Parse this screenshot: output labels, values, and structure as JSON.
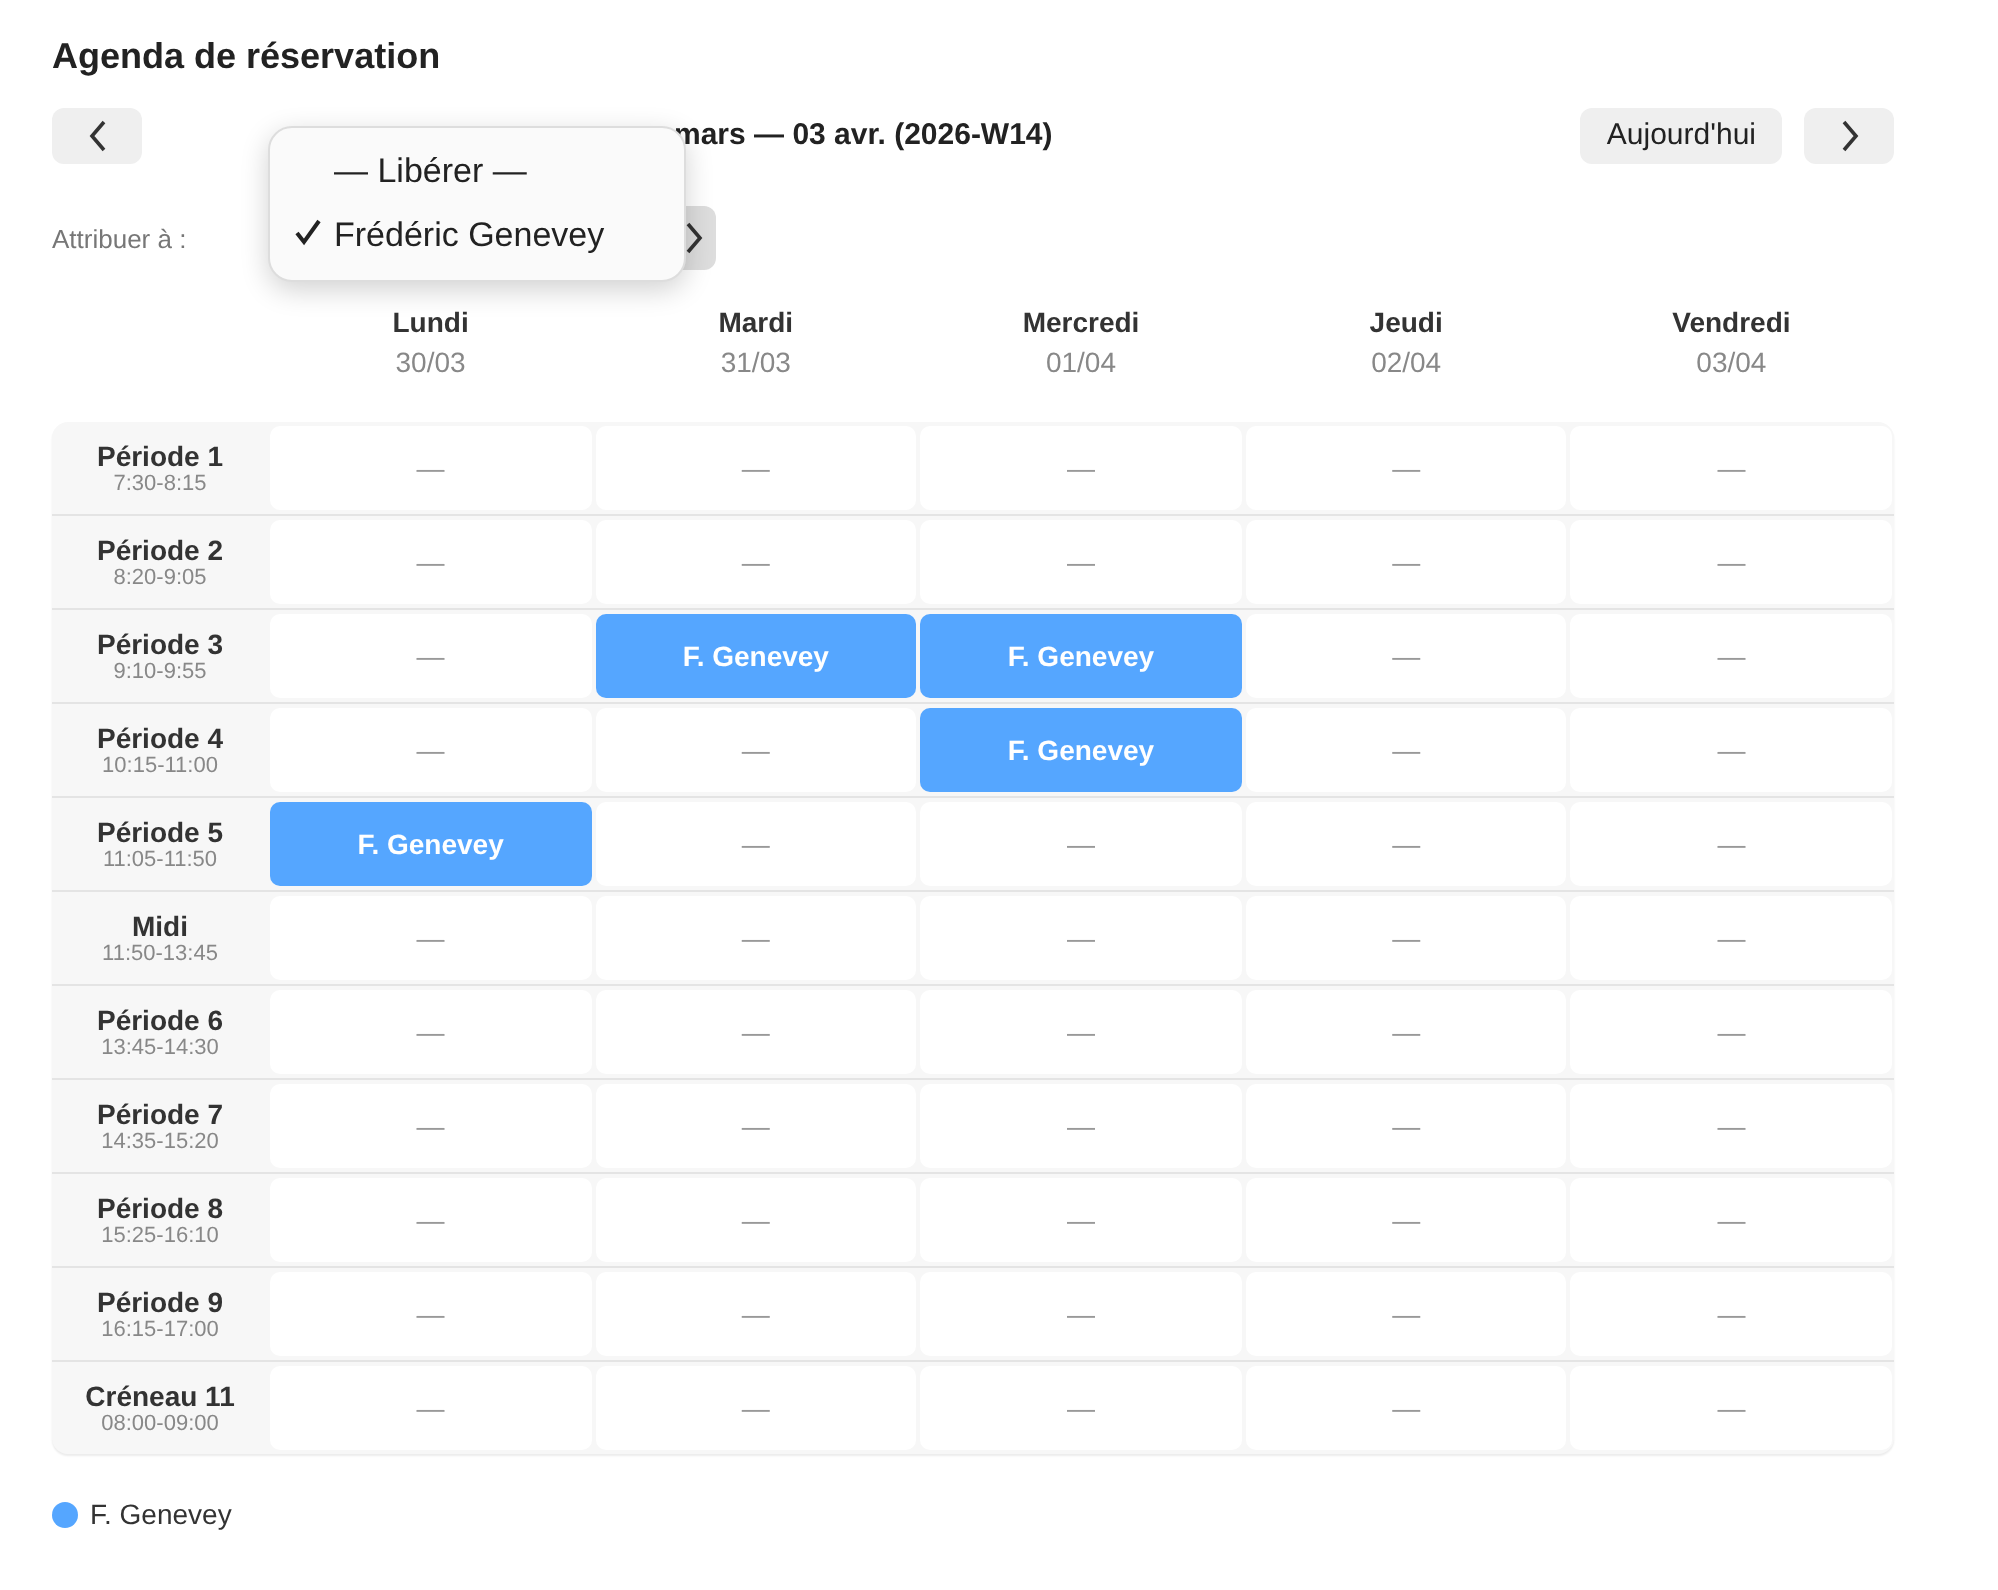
{
  "title": "Agenda de réservation",
  "nav": {
    "today": "Aujourd'hui",
    "week": "mars — 03 avr. (2026-W14)"
  },
  "assign": {
    "label": "Attribuer à :",
    "menu": [
      {
        "label": "— Libérer —",
        "selected": false
      },
      {
        "label": "Frédéric Genevey",
        "selected": true
      }
    ]
  },
  "days": [
    {
      "name": "Lundi",
      "date": "30/03"
    },
    {
      "name": "Mardi",
      "date": "31/03"
    },
    {
      "name": "Mercredi",
      "date": "01/04"
    },
    {
      "name": "Jeudi",
      "date": "02/04"
    },
    {
      "name": "Vendredi",
      "date": "03/04"
    }
  ],
  "rows": [
    {
      "label": "Période 1",
      "time": "7:30-8:15",
      "cells": [
        {
          "kind": "empty",
          "text": "—"
        },
        {
          "kind": "empty",
          "text": "—"
        },
        {
          "kind": "empty",
          "text": "—"
        },
        {
          "kind": "empty",
          "text": "—"
        },
        {
          "kind": "empty",
          "text": "—"
        }
      ]
    },
    {
      "label": "Période 2",
      "time": "8:20-9:05",
      "cells": [
        {
          "kind": "empty",
          "text": "—"
        },
        {
          "kind": "empty",
          "text": "—"
        },
        {
          "kind": "empty",
          "text": "—"
        },
        {
          "kind": "empty",
          "text": "—"
        },
        {
          "kind": "empty",
          "text": "—"
        }
      ]
    },
    {
      "label": "Période 3",
      "time": "9:10-9:55",
      "cells": [
        {
          "kind": "empty",
          "text": "—"
        },
        {
          "kind": "booked",
          "text": "F. Genevey",
          "color": "#55a6ff"
        },
        {
          "kind": "booked",
          "text": "F. Genevey",
          "color": "#55a6ff"
        },
        {
          "kind": "empty",
          "text": "—"
        },
        {
          "kind": "empty",
          "text": "—"
        }
      ]
    },
    {
      "label": "Période 4",
      "time": "10:15-11:00",
      "cells": [
        {
          "kind": "empty",
          "text": "—"
        },
        {
          "kind": "empty",
          "text": "—"
        },
        {
          "kind": "booked",
          "text": "F. Genevey",
          "color": "#55a6ff"
        },
        {
          "kind": "empty",
          "text": "—"
        },
        {
          "kind": "empty",
          "text": "—"
        }
      ]
    },
    {
      "label": "Période 5",
      "time": "11:05-11:50",
      "cells": [
        {
          "kind": "booked",
          "text": "F. Genevey",
          "color": "#55a6ff"
        },
        {
          "kind": "empty",
          "text": "—"
        },
        {
          "kind": "empty",
          "text": "—"
        },
        {
          "kind": "empty",
          "text": "—"
        },
        {
          "kind": "empty",
          "text": "—"
        }
      ]
    },
    {
      "label": "Midi",
      "time": "11:50-13:45",
      "cells": [
        {
          "kind": "empty",
          "text": "—"
        },
        {
          "kind": "empty",
          "text": "—"
        },
        {
          "kind": "empty",
          "text": "—"
        },
        {
          "kind": "empty",
          "text": "—"
        },
        {
          "kind": "empty",
          "text": "—"
        }
      ]
    },
    {
      "label": "Période 6",
      "time": "13:45-14:30",
      "cells": [
        {
          "kind": "empty",
          "text": "—"
        },
        {
          "kind": "empty",
          "text": "—"
        },
        {
          "kind": "empty",
          "text": "—"
        },
        {
          "kind": "empty",
          "text": "—"
        },
        {
          "kind": "empty",
          "text": "—"
        }
      ]
    },
    {
      "label": "Période 7",
      "time": "14:35-15:20",
      "cells": [
        {
          "kind": "empty",
          "text": "—"
        },
        {
          "kind": "empty",
          "text": "—"
        },
        {
          "kind": "empty",
          "text": "—"
        },
        {
          "kind": "empty",
          "text": "—"
        },
        {
          "kind": "empty",
          "text": "—"
        }
      ]
    },
    {
      "label": "Période 8",
      "time": "15:25-16:10",
      "cells": [
        {
          "kind": "empty",
          "text": "—"
        },
        {
          "kind": "empty",
          "text": "—"
        },
        {
          "kind": "empty",
          "text": "—"
        },
        {
          "kind": "empty",
          "text": "—"
        },
        {
          "kind": "empty",
          "text": "—"
        }
      ]
    },
    {
      "label": "Période 9",
      "time": "16:15-17:00",
      "cells": [
        {
          "kind": "empty",
          "text": "—"
        },
        {
          "kind": "empty",
          "text": "—"
        },
        {
          "kind": "empty",
          "text": "—"
        },
        {
          "kind": "empty",
          "text": "—"
        },
        {
          "kind": "empty",
          "text": "—"
        }
      ]
    },
    {
      "label": "Créneau 11",
      "time": "08:00-09:00",
      "cells": [
        {
          "kind": "empty",
          "text": "—"
        },
        {
          "kind": "empty",
          "text": "—"
        },
        {
          "kind": "empty",
          "text": "—"
        },
        {
          "kind": "empty",
          "text": "—"
        },
        {
          "kind": "empty",
          "text": "—"
        }
      ]
    }
  ],
  "legend": [
    {
      "label": "F. Genevey",
      "color": "#55a6ff"
    }
  ]
}
